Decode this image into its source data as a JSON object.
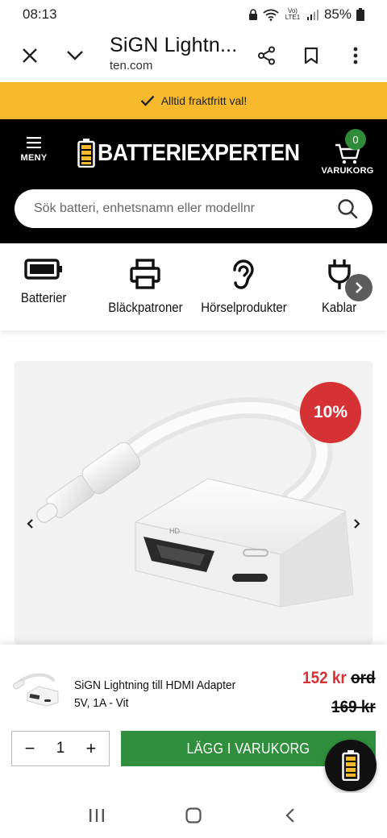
{
  "status_bar": {
    "time": "08:13",
    "network": "Vo) LTE1",
    "battery": "85%"
  },
  "browser": {
    "title": "SiGN Lightn...",
    "url": "ten.com"
  },
  "promo": {
    "text": "Alltid fraktfritt val!"
  },
  "header": {
    "menu_label": "MENY",
    "logo_text": "BATTERIEXPERTEN",
    "cart_label": "VARUKORG",
    "cart_count": "0",
    "search_placeholder": "Sök batteri, enhetsnamn eller modellnr"
  },
  "categories": [
    {
      "label": "Batterier",
      "icon": "battery-icon"
    },
    {
      "label": "Bläckpatroner",
      "icon": "printer-icon"
    },
    {
      "label": "Hörselprodukter",
      "icon": "ear-icon"
    },
    {
      "label": "Kablar",
      "icon": "plug-icon"
    }
  ],
  "product": {
    "discount": "10%",
    "hd_label": "HD",
    "name": "SiGN Lightning till HDMI Adapter 5V, 1A - Vit",
    "price": "152 kr",
    "price_suffix": "ord",
    "old_price": "169 kr",
    "quantity": "1",
    "qty_minus": "−",
    "qty_plus": "+",
    "add_to_cart": "LÄGG I VARUKORG"
  },
  "colors": {
    "promo": "#f7b92c",
    "header": "#000000",
    "accent_green": "#2f8f3c",
    "discount_red": "#d63134"
  }
}
